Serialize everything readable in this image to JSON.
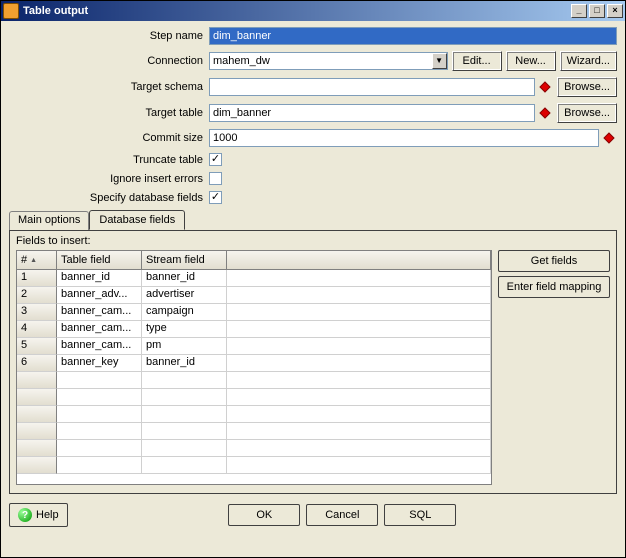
{
  "window": {
    "title": "Table output"
  },
  "form": {
    "step_name": {
      "label": "Step name",
      "value": "dim_banner"
    },
    "connection": {
      "label": "Connection",
      "value": "mahem_dw",
      "edit": "Edit...",
      "new": "New...",
      "wizard": "Wizard..."
    },
    "target_schema": {
      "label": "Target schema",
      "value": "",
      "browse": "Browse..."
    },
    "target_table": {
      "label": "Target table",
      "value": "dim_banner",
      "browse": "Browse..."
    },
    "commit_size": {
      "label": "Commit size",
      "value": "1000"
    },
    "truncate_table": {
      "label": "Truncate table",
      "checked": true
    },
    "ignore_insert_errors": {
      "label": "Ignore insert errors",
      "checked": false
    },
    "specify_db_fields": {
      "label": "Specify database fields",
      "checked": true
    }
  },
  "tabs": {
    "main": "Main options",
    "dbfields": "Database fields"
  },
  "fields": {
    "title": "Fields to insert:",
    "headers": {
      "num": "#",
      "table_field": "Table field",
      "stream_field": "Stream field"
    },
    "rows": [
      {
        "n": "1",
        "tf": "banner_id",
        "sf": "banner_id"
      },
      {
        "n": "2",
        "tf": "banner_adv...",
        "sf": "advertiser"
      },
      {
        "n": "3",
        "tf": "banner_cam...",
        "sf": "campaign"
      },
      {
        "n": "4",
        "tf": "banner_cam...",
        "sf": "type"
      },
      {
        "n": "5",
        "tf": "banner_cam...",
        "sf": "pm"
      },
      {
        "n": "6",
        "tf": "banner_key",
        "sf": "banner_id"
      }
    ],
    "get_fields": "Get fields",
    "enter_mapping": "Enter field mapping"
  },
  "footer": {
    "help": "Help",
    "ok": "OK",
    "cancel": "Cancel",
    "sql": "SQL"
  }
}
